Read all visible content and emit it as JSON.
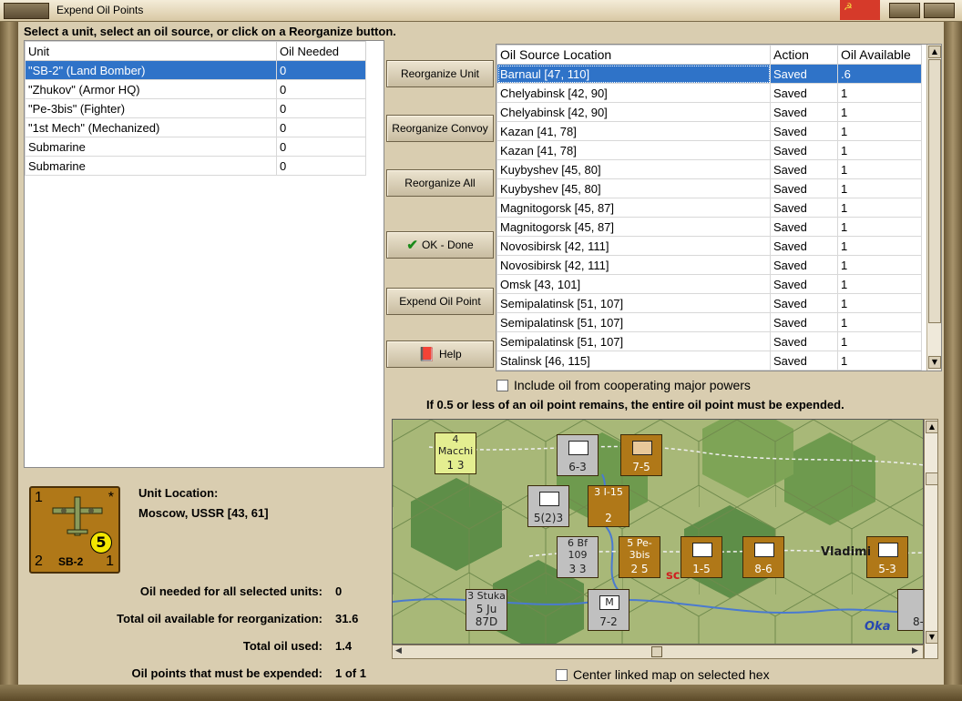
{
  "window": {
    "title": "Expend Oil Points"
  },
  "instruction": "Select a unit, select an oil source, or click on a Reorganize button.",
  "units": {
    "headers": [
      "Unit",
      "Oil Needed"
    ],
    "rows": [
      {
        "unit": "\"SB-2\" (Land Bomber)",
        "oil": "0",
        "selected": true
      },
      {
        "unit": "\"Zhukov\" (Armor HQ)",
        "oil": "0"
      },
      {
        "unit": "\"Pe-3bis\" (Fighter)",
        "oil": "0"
      },
      {
        "unit": "\"1st Mech\" (Mechanized)",
        "oil": "0"
      },
      {
        "unit": "Submarine",
        "oil": "0"
      },
      {
        "unit": "Submarine",
        "oil": "0"
      }
    ]
  },
  "buttons": {
    "reorg_unit": "Reorganize Unit",
    "reorg_convoy": "Reorganize Convoy",
    "reorg_all": "Reorganize All",
    "ok": "OK - Done",
    "expend": "Expend Oil Point",
    "help": "Help"
  },
  "oil_sources": {
    "headers": [
      "Oil Source Location",
      "Action",
      "Oil Available"
    ],
    "rows": [
      {
        "loc": "Barnaul [47, 110]",
        "action": "Saved",
        "avail": ".6",
        "selected": true
      },
      {
        "loc": "Chelyabinsk [42, 90]",
        "action": "Saved",
        "avail": "1"
      },
      {
        "loc": "Chelyabinsk [42, 90]",
        "action": "Saved",
        "avail": "1"
      },
      {
        "loc": "Kazan [41, 78]",
        "action": "Saved",
        "avail": "1"
      },
      {
        "loc": "Kazan [41, 78]",
        "action": "Saved",
        "avail": "1"
      },
      {
        "loc": "Kuybyshev [45, 80]",
        "action": "Saved",
        "avail": "1"
      },
      {
        "loc": "Kuybyshev [45, 80]",
        "action": "Saved",
        "avail": "1"
      },
      {
        "loc": "Magnitogorsk [45, 87]",
        "action": "Saved",
        "avail": "1"
      },
      {
        "loc": "Magnitogorsk [45, 87]",
        "action": "Saved",
        "avail": "1"
      },
      {
        "loc": "Novosibirsk [42, 111]",
        "action": "Saved",
        "avail": "1"
      },
      {
        "loc": "Novosibirsk [42, 111]",
        "action": "Saved",
        "avail": "1"
      },
      {
        "loc": "Omsk [43, 101]",
        "action": "Saved",
        "avail": "1"
      },
      {
        "loc": "Semipalatinsk [51, 107]",
        "action": "Saved",
        "avail": "1"
      },
      {
        "loc": "Semipalatinsk [51, 107]",
        "action": "Saved",
        "avail": "1"
      },
      {
        "loc": "Semipalatinsk [51, 107]",
        "action": "Saved",
        "avail": "1"
      },
      {
        "loc": "Stalinsk [46, 115]",
        "action": "Saved",
        "avail": "1"
      }
    ]
  },
  "include_cooperating": "Include oil from cooperating major powers",
  "oil_rule": "If 0.5 or less of an oil point remains, the entire oil point must be expended.",
  "center_map": "Center linked map on selected hex",
  "map": {
    "labels": {
      "city": "Vladimi",
      "river": "Oka",
      "partial": "sc"
    },
    "counters": [
      {
        "top": "4  Macchi",
        "bottom": "1   3",
        "cls": "yellow"
      },
      {
        "top": "xxx",
        "bottom": "6-3",
        "cls": "grey"
      },
      {
        "top": "xxxx",
        "bottom": "7-5",
        "cls": "brown"
      },
      {
        "top": "xxxxx",
        "bottom": "5(2)3",
        "cls": "grey"
      },
      {
        "top": "3  I-15",
        "bottom": "2",
        "cls": "brown"
      },
      {
        "top": "6  Bf 109",
        "bottom": "3   3",
        "cls": "grey"
      },
      {
        "top": "5  Pe-3bis",
        "bottom": "2   5",
        "cls": "brown"
      },
      {
        "top": "xx",
        "bottom": "1-5",
        "cls": "brown"
      },
      {
        "top": "xxxx",
        "bottom": "8-6",
        "cls": "brown"
      },
      {
        "top": "xxxx",
        "bottom": "5-3",
        "cls": "brown"
      },
      {
        "top": "3  Stuka",
        "bottom": "5  Ju 87D",
        "cls": "grey"
      },
      {
        "top": "M",
        "bottom": "7-2",
        "cls": "grey"
      },
      {
        "top": "",
        "bottom": "8-",
        "cls": "grey"
      }
    ]
  },
  "unit_info": {
    "chit": {
      "tl": "1",
      "tr": "*",
      "bl": "2",
      "br": "1",
      "mid": "5",
      "name": "SB-2"
    },
    "location_label": "Unit Location:",
    "location_value": "Moscow, USSR [43, 61]",
    "stats": [
      {
        "label": "Oil needed for all selected units:",
        "value": "0"
      },
      {
        "label": "Total oil available for reorganization:",
        "value": "31.6"
      },
      {
        "label": "Total oil used:",
        "value": "1.4"
      },
      {
        "label": "Oil points that must be expended:",
        "value": "1 of 1"
      }
    ]
  }
}
